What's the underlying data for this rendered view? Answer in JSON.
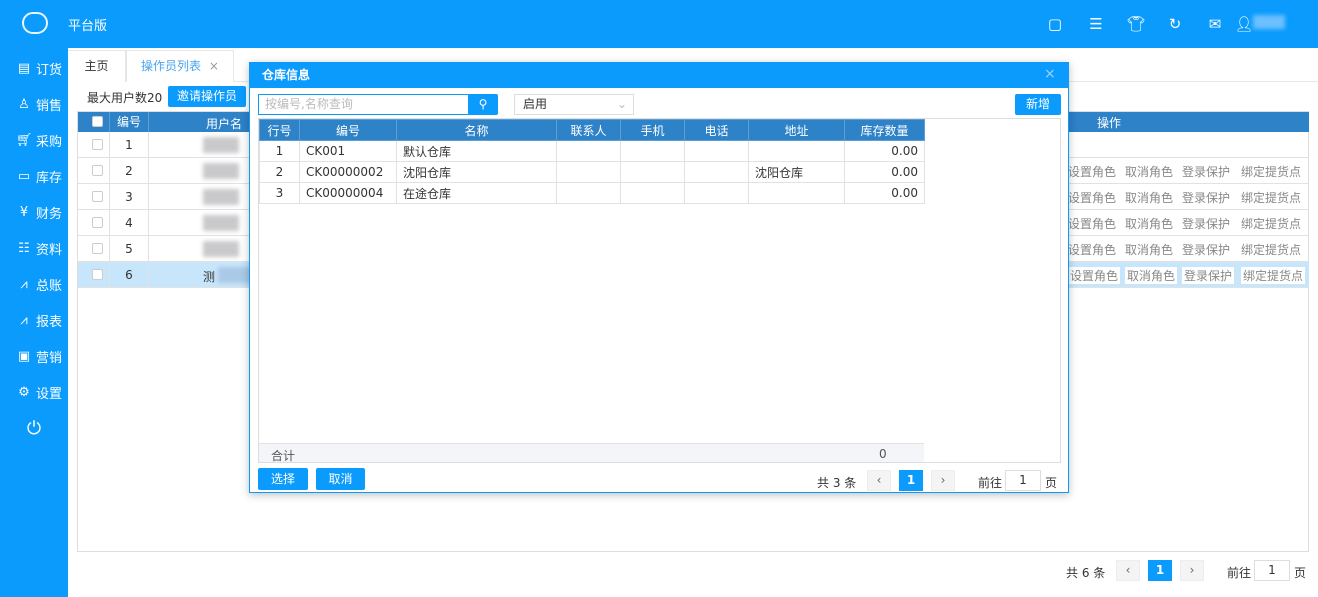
{
  "app": {
    "title": "平台版",
    "top_icons": [
      "screen-icon",
      "menu-icon",
      "shirt-icon",
      "refresh-icon",
      "mail-icon",
      "user-icon"
    ]
  },
  "sidebar": [
    {
      "label": "订货",
      "icon": "clipboard-icon"
    },
    {
      "label": "销售",
      "icon": "person-icon"
    },
    {
      "label": "采购",
      "icon": "cart-icon"
    },
    {
      "label": "库存",
      "icon": "box-icon"
    },
    {
      "label": "财务",
      "icon": "money-icon"
    },
    {
      "label": "资料",
      "icon": "contact-icon"
    },
    {
      "label": "总账",
      "icon": "chart-icon"
    },
    {
      "label": "报表",
      "icon": "chart-icon"
    },
    {
      "label": "营销",
      "icon": "monitor-icon"
    },
    {
      "label": "设置",
      "icon": "gear-icon"
    }
  ],
  "tabs": {
    "home": "主页",
    "operators": "操作员列表",
    "close": "×"
  },
  "main": {
    "max_users": "最大用户数20",
    "invite": "邀请操作员",
    "headers": {
      "no": "编号",
      "username": "用户名",
      "ops": "操作"
    },
    "rows": [
      {
        "no": "1",
        "name": ""
      },
      {
        "no": "2",
        "name": ""
      },
      {
        "no": "3",
        "name": ""
      },
      {
        "no": "4",
        "name": ""
      },
      {
        "no": "5",
        "name": ""
      },
      {
        "no": "6",
        "name": "测"
      }
    ],
    "ops": [
      "设置角色",
      "取消角色",
      "登录保护",
      "绑定提货点"
    ],
    "pager": {
      "total": "共 6 条",
      "page": "1",
      "goto": "前往",
      "input": "1",
      "unit": "页"
    }
  },
  "dialog": {
    "title": "仓库信息",
    "close": "×",
    "search_placeholder": "按编号,名称查询",
    "status": "启用",
    "add": "新增",
    "headers": [
      "行号",
      "编号",
      "名称",
      "联系人",
      "手机",
      "电话",
      "地址",
      "库存数量"
    ],
    "rows": [
      [
        "1",
        "CK001",
        "默认仓库",
        "",
        "",
        "",
        "",
        "0.00"
      ],
      [
        "2",
        "CK00000002",
        "沈阳仓库",
        "",
        "",
        "",
        "沈阳仓库",
        "0.00"
      ],
      [
        "3",
        "CK00000004",
        "在途仓库",
        "",
        "",
        "",
        "",
        "0.00"
      ]
    ],
    "total_label": "合计",
    "total_value": "0",
    "select": "选择",
    "cancel": "取消",
    "pager": {
      "total": "共 3 条",
      "page": "1",
      "goto": "前往",
      "input": "1",
      "unit": "页"
    }
  }
}
